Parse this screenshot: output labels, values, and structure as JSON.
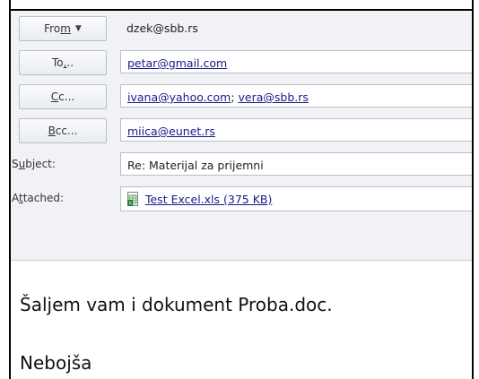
{
  "from": {
    "button_label_pre": "Fro",
    "button_label_u": "m",
    "caret": "▼",
    "value": "dzek@sbb.rs"
  },
  "to": {
    "button_label_pre": "To",
    "button_label_u": ",",
    "button_label_post": "..",
    "value": "petar@gmail.com"
  },
  "cc": {
    "button_label_u": "C",
    "button_label_post": "c...",
    "values": [
      "ivana@yahoo.com",
      "vera@sbb.rs"
    ],
    "separator": "; "
  },
  "bcc": {
    "button_label_u": "B",
    "button_label_post": "cc...",
    "value": "miica@eunet.rs"
  },
  "subject": {
    "label_pre": "S",
    "label_u": "u",
    "label_post": "bject:",
    "value": "Re: Materijal za prijemni"
  },
  "attached": {
    "label_pre": "A",
    "label_u": "t",
    "label_post": "tached:",
    "file": "Test Excel.xls (375 KB)",
    "icon": "excel-file-icon"
  },
  "body": {
    "line1": "Šaljem vam i dokument  Proba.doc.",
    "line2": "Nebojša"
  }
}
